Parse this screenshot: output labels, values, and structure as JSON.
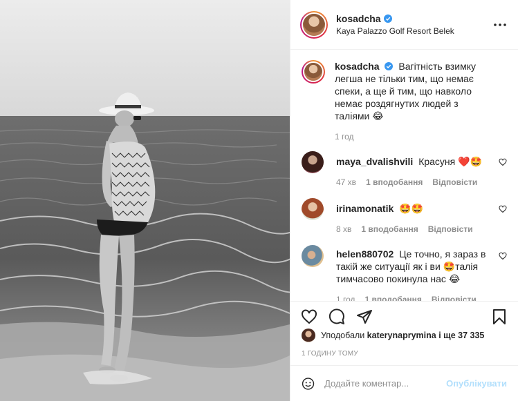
{
  "post": {
    "username": "kosadcha",
    "location": "Kaya Palazzo Golf Resort Belek",
    "caption": "Вагітність взимку легша не тільки тим, що немає спеки, а ще й тим, що навколо немає роздягнутих людей з таліями 😂",
    "caption_time": "1 год",
    "time_ago": "1 годину тому"
  },
  "comments": [
    {
      "username": "maya_dvalishvili",
      "text": "Красуня ❤️🤩",
      "time": "47 хв",
      "likes": "1 вподобання",
      "reply": "Відповісти"
    },
    {
      "username": "irinamonatik",
      "text": "🤩🤩",
      "time": "8 хв",
      "likes": "1 вподобання",
      "reply": "Відповісти"
    },
    {
      "username": "helen880702",
      "text": "Це точно, я зараз в такій же ситуації як і ви 🤩талія тимчасово покинула нас 😂",
      "time": "1 год",
      "likes": "1 вподобання",
      "reply": "Відповісти"
    }
  ],
  "likes": {
    "prefix": "Уподобали",
    "user": "katerynaprymina",
    "suffix": "і ще 37 335"
  },
  "add_comment": {
    "placeholder": "Додайте коментар...",
    "publish": "Опублікувати"
  },
  "icons": {
    "verified": "verified-badge-icon",
    "more": "more-options-icon",
    "like": "heart-icon",
    "comment": "comment-icon",
    "share": "share-icon",
    "save": "bookmark-icon",
    "emoji": "emoji-icon"
  },
  "colors": {
    "verified": "#3897f0",
    "muted": "#8e8e8e",
    "publish_disabled": "#b2dffc"
  }
}
